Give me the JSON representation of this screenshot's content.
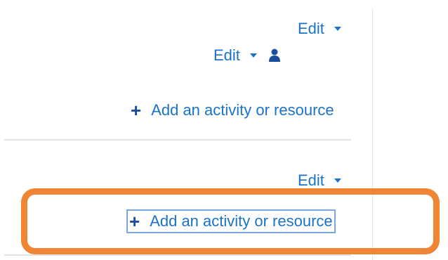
{
  "section1": {
    "edit_label": "Edit",
    "activity_edit_label": "Edit",
    "add_label": "Add an activity or resource"
  },
  "section2": {
    "edit_label": "Edit",
    "add_label": "Add an activity or resource"
  },
  "colors": {
    "link": "#1a73c7",
    "highlight": "#ef8635"
  }
}
